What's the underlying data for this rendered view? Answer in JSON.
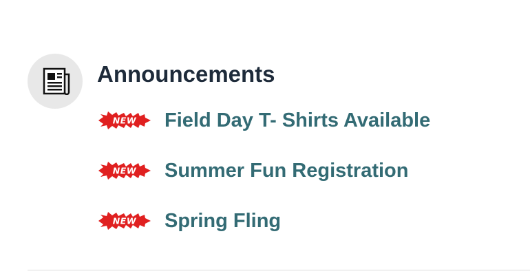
{
  "announcements": {
    "icon": "newspaper-icon",
    "title": "Announcements",
    "badge_color": "#e02020",
    "link_color": "#336b74",
    "items": [
      {
        "badge": "NEW",
        "label": "Field Day T- Shirts Available"
      },
      {
        "badge": "NEW",
        "label": "Summer Fun Registration"
      },
      {
        "badge": "NEW",
        "label": "Spring Fling"
      }
    ]
  }
}
